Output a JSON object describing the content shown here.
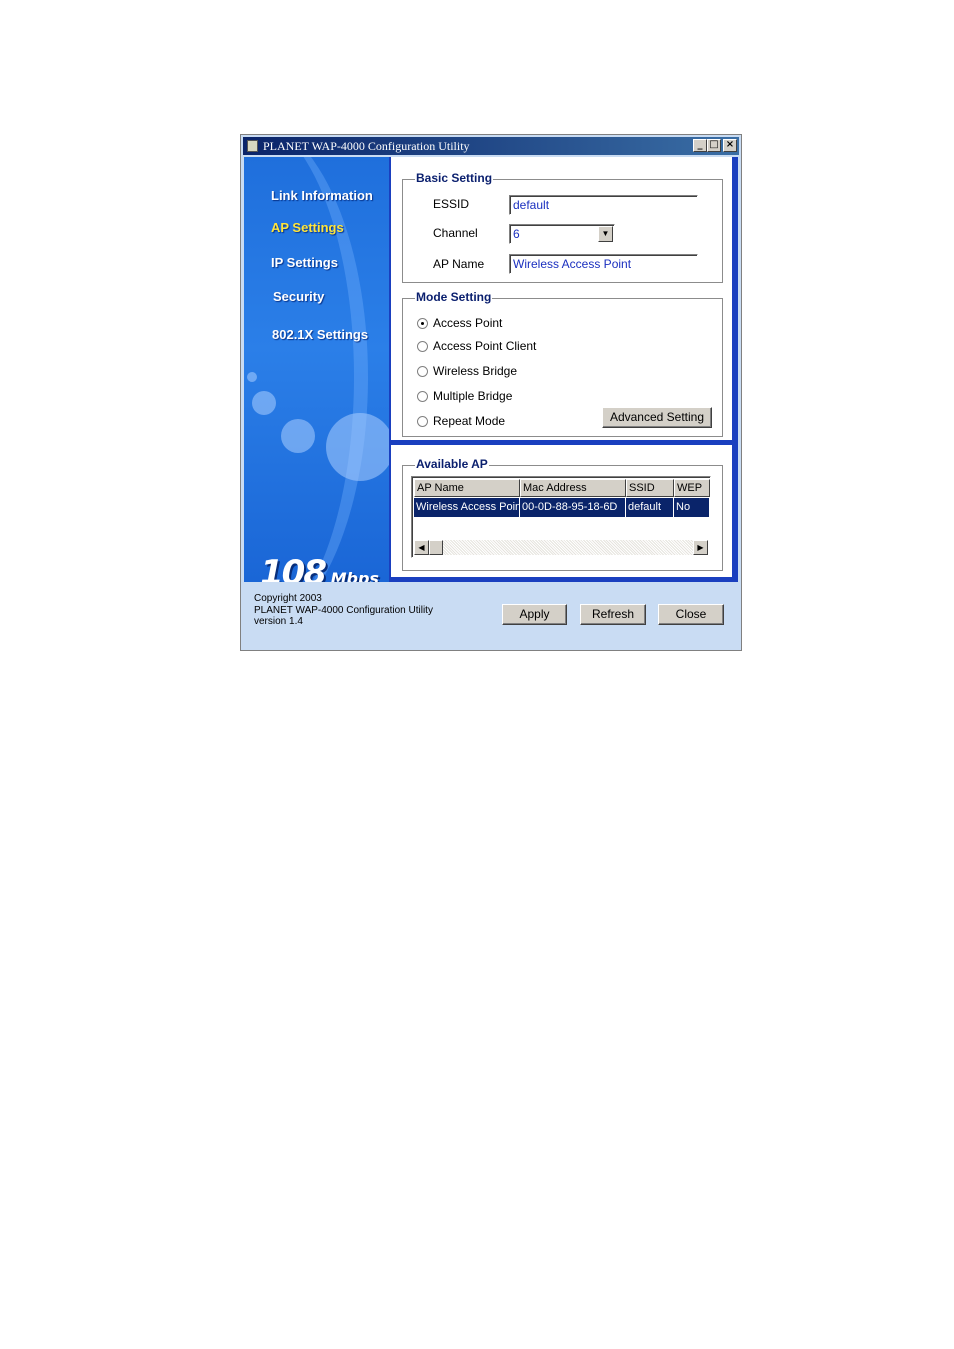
{
  "window": {
    "title": "PLANET WAP-4000 Configuration Utility",
    "controls": {
      "minimize": "_",
      "maximize": "□",
      "close": "×"
    }
  },
  "sidebar": {
    "items": [
      {
        "label": "Link Information",
        "active": false
      },
      {
        "label": "AP Settings",
        "active": true
      },
      {
        "label": "IP Settings",
        "active": false
      },
      {
        "label": "Security",
        "active": false
      },
      {
        "label": "802.1X Settings",
        "active": false
      }
    ],
    "logo_big": "108",
    "logo_small": "Mbps"
  },
  "basic_setting": {
    "title": "Basic Setting",
    "essid_label": "ESSID",
    "essid_value": "default",
    "channel_label": "Channel",
    "channel_value": "6",
    "ap_name_label": "AP Name",
    "ap_name_value": "Wireless Access Point"
  },
  "mode_setting": {
    "title": "Mode Setting",
    "options": [
      {
        "label": "Access Point",
        "selected": true
      },
      {
        "label": "Access Point Client",
        "selected": false
      },
      {
        "label": "Wireless Bridge",
        "selected": false
      },
      {
        "label": "Multiple Bridge",
        "selected": false
      },
      {
        "label": "Repeat Mode",
        "selected": false
      }
    ],
    "advanced_button": "Advanced Setting"
  },
  "available_ap": {
    "title": "Available AP",
    "columns": [
      "AP Name",
      "Mac Address",
      "SSID",
      "WEP"
    ],
    "rows": [
      [
        "Wireless Access Point",
        "00-0D-88-95-18-6D",
        "default",
        "No"
      ]
    ]
  },
  "footer": {
    "copyright": "Copyright 2003",
    "product": "PLANET WAP-4000 Configuration Utility",
    "version": "version 1.4",
    "apply": "Apply",
    "refresh": "Refresh",
    "close": "Close"
  },
  "colors": {
    "sidebar_blue": "#2b7fe8",
    "active_nav": "#ffe53a",
    "selection": "#0a246a",
    "footer_bg": "#c9dcf3"
  }
}
